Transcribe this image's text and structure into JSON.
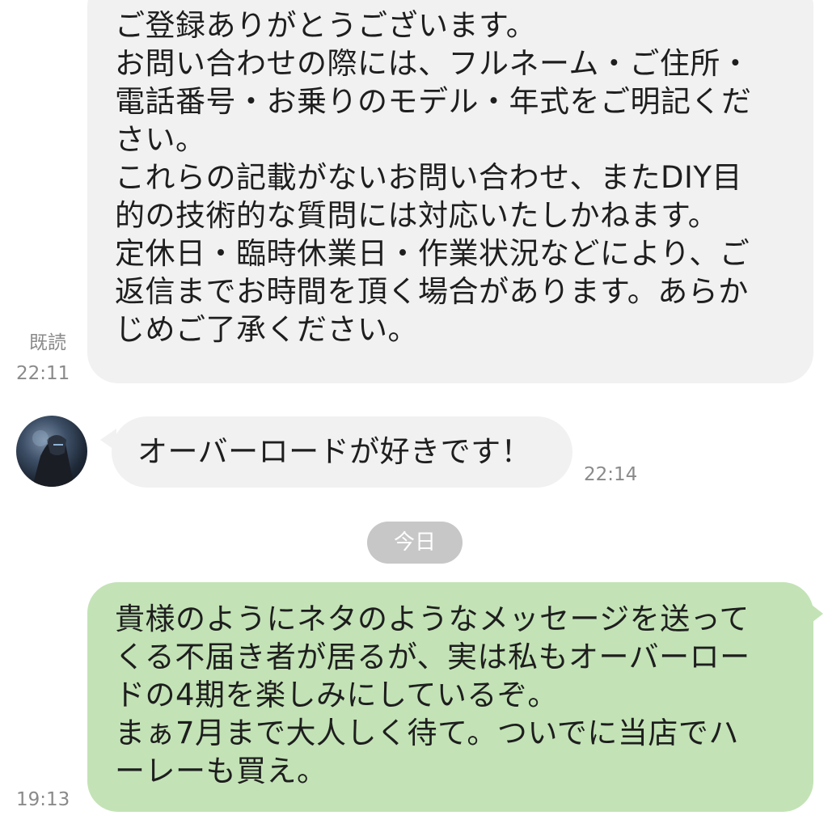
{
  "messages": [
    {
      "text": "ご登録ありがとうございます。\nお問い合わせの際には、フルネーム・ご住所・\n電話番号・お乗りのモデル・年式をご明記くだ\nさい。\nこれらの記載がないお問い合わせ、またDIY目\n的の技術的な質問には対応いたしかねます。\n定休日・臨時休業日・作業状況などにより、ご\n返信までお時間を頂く場合があります。あらか\nじめご了承ください。",
      "read_label": "既読",
      "time": "22:11"
    },
    {
      "text": "オーバーロードが好きです！",
      "time": "22:14"
    },
    {
      "text": "貴様のようにネタのようなメッセージを送って\nくる不届き者が居るが、実は私もオーバーロー\nドの4期を楽しみにしているぞ。\nまぁ7月まで大人しく待て。ついでに当店でハ\nーレーも買え。",
      "time": "19:13"
    }
  ],
  "date_separator": "今日",
  "colors": {
    "incoming_bubble": "#f1f1f1",
    "outgoing_bubble": "#c3e3b6",
    "date_chip": "#c7c7c7",
    "meta_text": "#8a8a8a"
  }
}
